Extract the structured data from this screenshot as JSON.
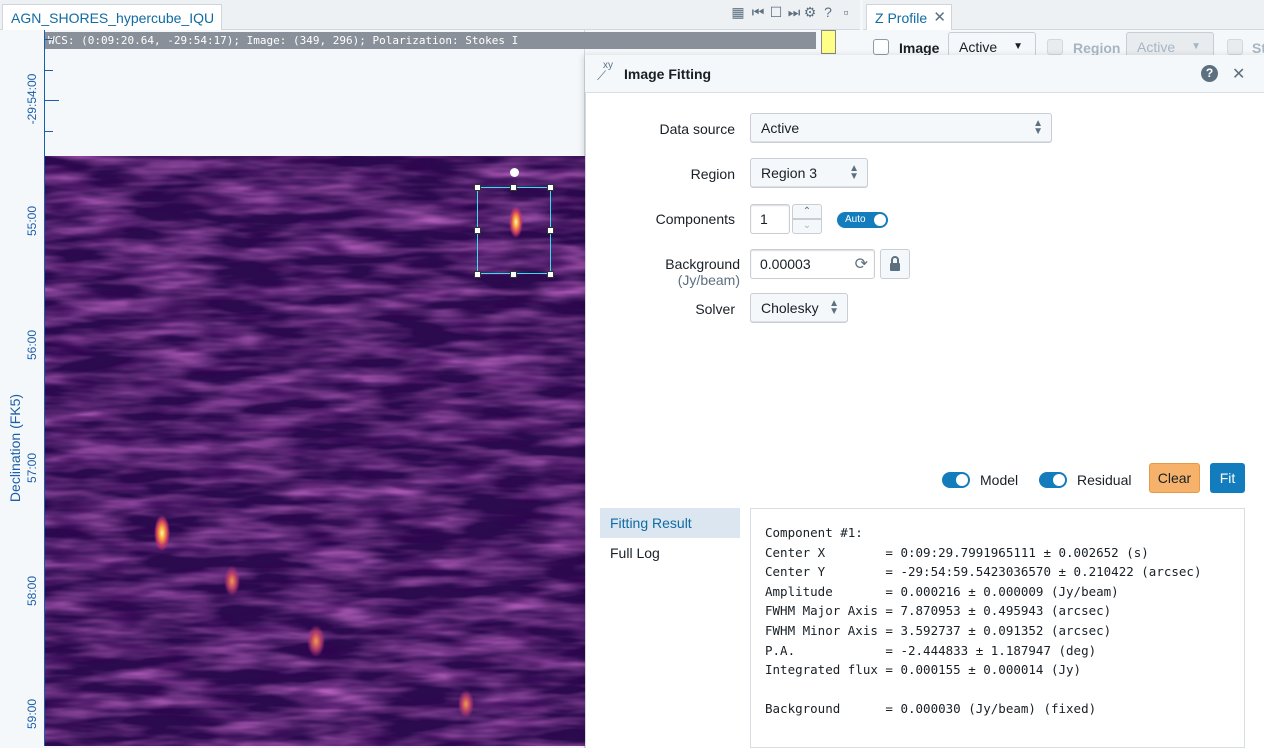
{
  "viewer": {
    "tab_title": "AGN_SHORES_hypercube_IQU",
    "cursor_info": "WCS: (0:09:20.64, -29:54:17); Image: (349, 296); Polarization: Stokes I",
    "axis_title": "Declination (FK5)",
    "y_tick_labels": [
      "-29:54:00",
      "55:00",
      "56:00",
      "57:00",
      "58:00",
      "59:00"
    ],
    "toolbar_icons": [
      "grid-icon",
      "first-frame-icon",
      "stop-icon",
      "next-frame-icon",
      "settings-icon",
      "help-icon",
      "minimize-icon"
    ]
  },
  "z_profile": {
    "tab_title": "Z Profile",
    "image_checkbox_label": "Image",
    "image_select": "Active",
    "region_checkbox_label": "Region",
    "region_select": "Active",
    "extra_label": "St"
  },
  "dialog": {
    "title": "Image Fitting",
    "title_icon": "xy",
    "labels": {
      "data_source": "Data source",
      "region": "Region",
      "components": "Components",
      "background": "Background",
      "background_unit": "(Jy/beam)",
      "solver": "Solver"
    },
    "values": {
      "data_source": "Active",
      "region": "Region 3",
      "components": "1",
      "auto_label": "Auto",
      "background": "0.00003",
      "solver": "Cholesky"
    },
    "toggles": {
      "model_label": "Model",
      "model_on": true,
      "residual_label": "Residual",
      "residual_on": true
    },
    "buttons": {
      "clear": "Clear",
      "fit": "Fit"
    },
    "result_tabs": [
      "Fitting Result",
      "Full Log"
    ],
    "active_result_tab": "Fitting Result",
    "result_lines": [
      "Component #1:",
      "Center X        = 0:09:29.7991965111 ± 0.002652 (s)",
      "Center Y        = -29:54:59.5423036570 ± 0.210422 (arcsec)",
      "Amplitude       = 0.000216 ± 0.000009 (Jy/beam)",
      "FWHM Major Axis = 7.870953 ± 0.495943 (arcsec)",
      "FWHM Minor Axis = 3.592737 ± 0.091352 (arcsec)",
      "P.A.            = -2.444833 ± 1.187947 (deg)",
      "Integrated flux = 0.000155 ± 0.000014 (Jy)",
      "",
      "Background      = 0.000030 (Jy/beam) (fixed)"
    ]
  },
  "colors": {
    "accent": "#137cbd",
    "clear_button": "#f6b26b",
    "region_outline": "#2ee3f0",
    "axis": "#1d5ea9",
    "image_bg": "#2b0a4e"
  }
}
